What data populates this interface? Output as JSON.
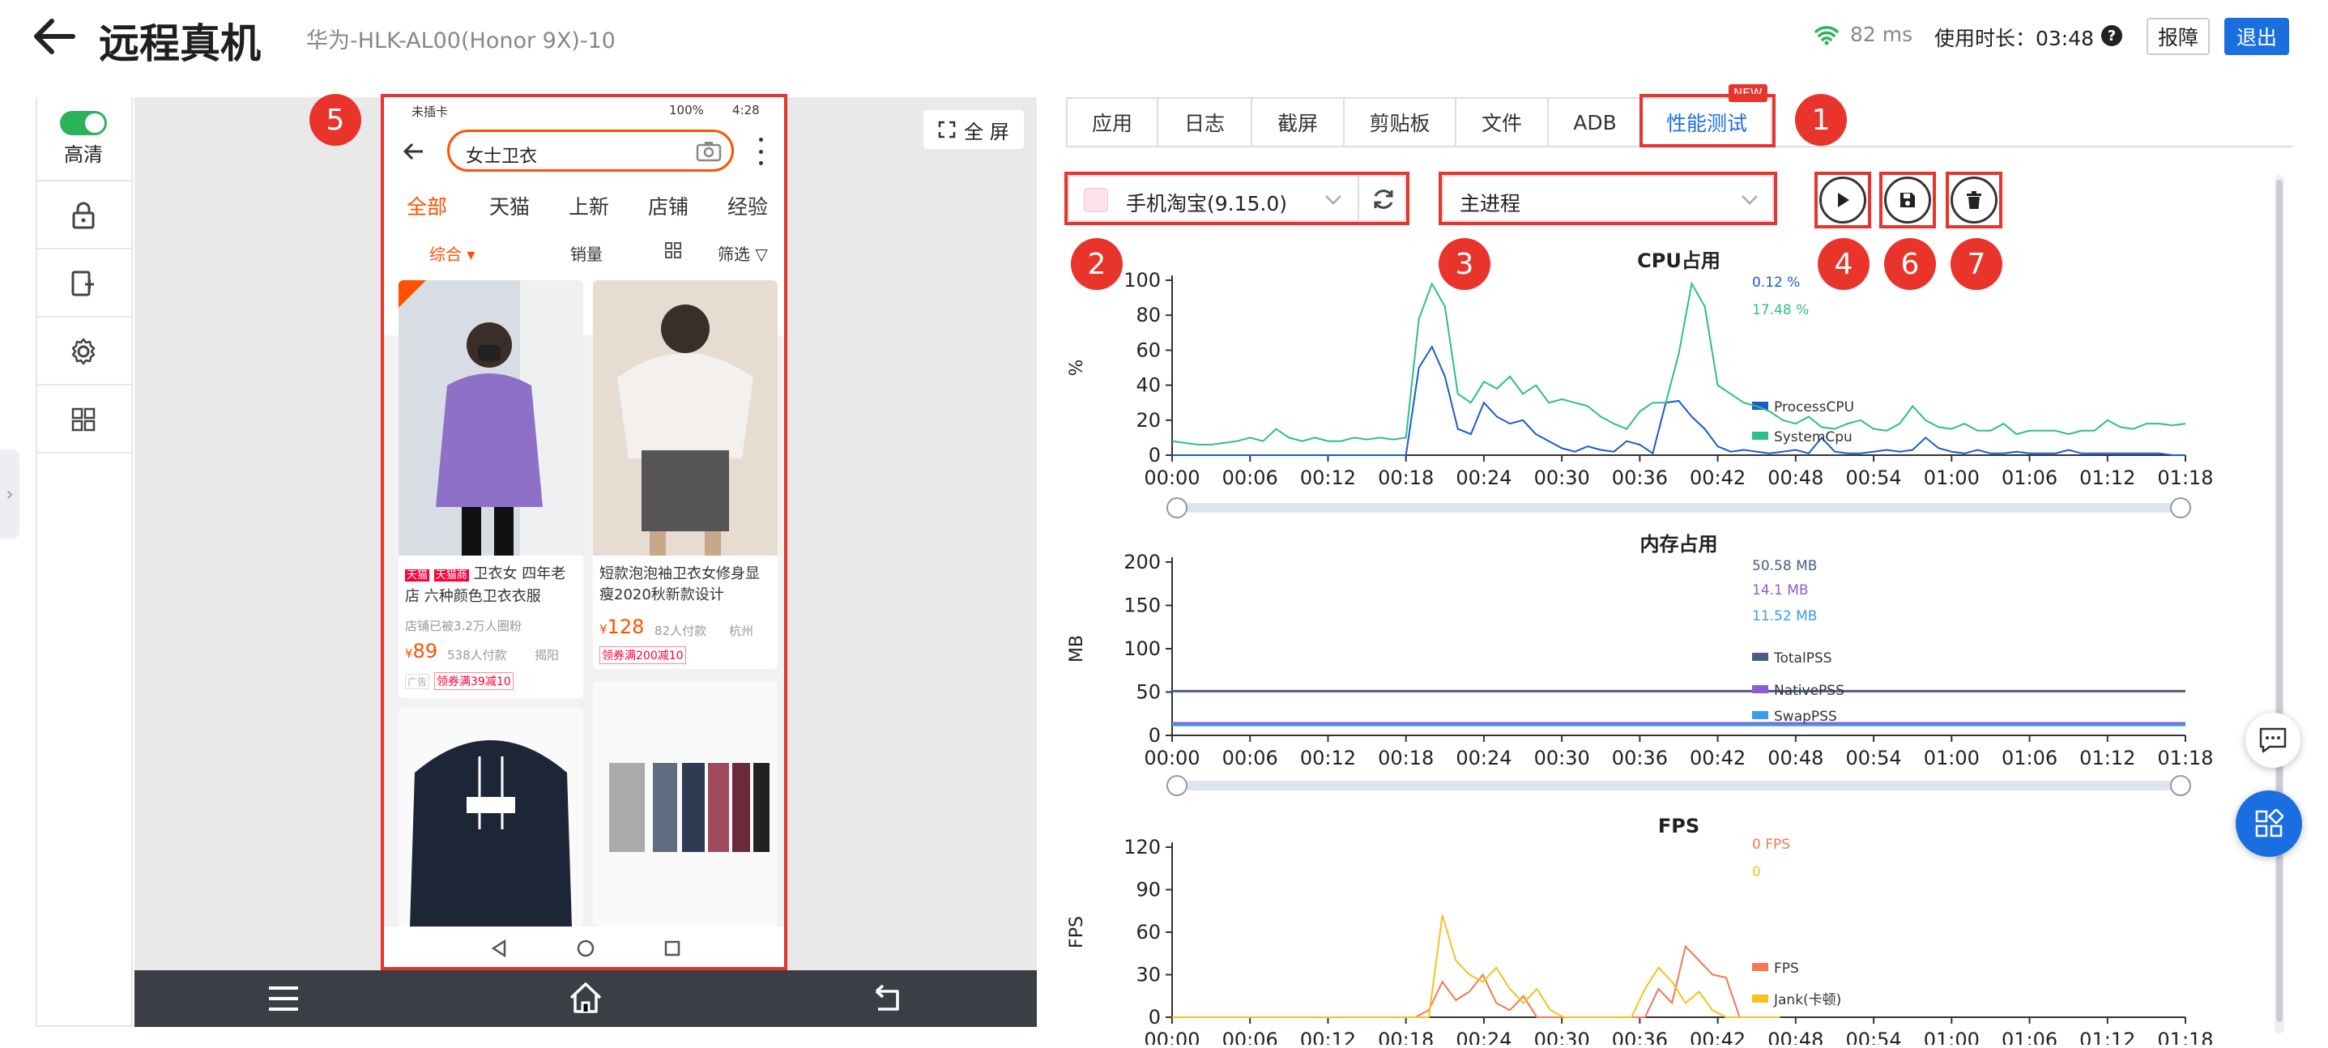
{
  "header": {
    "title": "远程真机",
    "device": "华为-HLK-AL00(Honor 9X)-10",
    "latency": "82 ms",
    "usage_label": "使用时长：03:48",
    "report_btn": "报障",
    "exit_btn": "退出",
    "help": "?"
  },
  "sidebar": {
    "hd_label": "高清"
  },
  "screen": {
    "fullscreen_label": "全 屏"
  },
  "phone": {
    "status_left": "未插卡",
    "status_right": "100% ",
    "status_time": "4:28",
    "search_text": "女士卫衣",
    "tabs": [
      "全部",
      "天猫",
      "上新",
      "店铺",
      "经验"
    ],
    "filters": [
      "综合",
      "销量",
      "筛选"
    ],
    "cards": [
      {
        "tag1": "天猫",
        "tag2": "天猫商",
        "title": "卫衣女 四年老店 六种颜色卫衣衣服",
        "sub": "店铺已被3.2万人圈粉",
        "price": "89",
        "sales": "538人付款",
        "loc": "揭阳",
        "coupon": "领券满39减10",
        "ad": "广告"
      },
      {
        "title": "短款泡泡袖卫衣女修身显瘦2020秋新款设计",
        "price": "128",
        "sales": "82人付款",
        "loc": "杭州",
        "coupon": "领券满200减10"
      }
    ],
    "yen": "¥"
  },
  "tabs": [
    "应用",
    "日志",
    "截屏",
    "剪贴板",
    "文件",
    "ADB",
    "性能测试"
  ],
  "new_badge": "NEW",
  "controls": {
    "app_select": "手机淘宝(9.15.0)",
    "process_select": "主进程"
  },
  "badges": [
    "1",
    "2",
    "3",
    "4",
    "5",
    "6",
    "7"
  ],
  "colors": {
    "accent": "#1a6fe0",
    "red": "#e8342b",
    "green": "#2ab35a",
    "orange": "#ff5000"
  },
  "x_ticks": [
    "00:00",
    "00:06",
    "00:12",
    "00:18",
    "00:24",
    "00:30",
    "00:36",
    "00:42",
    "00:48",
    "00:54",
    "01:00",
    "01:06",
    "01:12",
    "01:18"
  ],
  "chart_data": [
    {
      "type": "line",
      "title": "CPU占用",
      "ylabel": "%",
      "ylim": [
        0,
        100
      ],
      "yticks": [
        "0",
        "20",
        "40",
        "60",
        "80",
        "100"
      ],
      "x": [
        0,
        1,
        2,
        3,
        4,
        5,
        6,
        7,
        8,
        9,
        10,
        11,
        12,
        13,
        14,
        15,
        16,
        17,
        18,
        19,
        20,
        21,
        22,
        23,
        24,
        25,
        26,
        27,
        28,
        29,
        30,
        31,
        32,
        33,
        34,
        35,
        36,
        37,
        38,
        39,
        40,
        41,
        42,
        43,
        44,
        45,
        46,
        47,
        48,
        49,
        50,
        51,
        52,
        53,
        54,
        55,
        56,
        57,
        58,
        59,
        60,
        61,
        62,
        63,
        64,
        65,
        66,
        67,
        68,
        69,
        70,
        71,
        72,
        73,
        74,
        75,
        76,
        77,
        78
      ],
      "series": [
        {
          "name": "ProcessCPU",
          "color": "#1a5cc8",
          "value_label": "0.12 %",
          "values": [
            0,
            0,
            0,
            0,
            0,
            0,
            0,
            0,
            0,
            0,
            0,
            0,
            0,
            0,
            0,
            0,
            0,
            0,
            0,
            50,
            62,
            45,
            15,
            12,
            30,
            22,
            18,
            20,
            12,
            8,
            4,
            2,
            5,
            3,
            2,
            8,
            6,
            1,
            30,
            31,
            22,
            15,
            5,
            2,
            3,
            2,
            1,
            2,
            3,
            1,
            10,
            2,
            1,
            1,
            2,
            3,
            2,
            3,
            10,
            4,
            2,
            1,
            3,
            1,
            1,
            2,
            1,
            1,
            1,
            3,
            1,
            1,
            1,
            1,
            1,
            1,
            1,
            0,
            0
          ]
        },
        {
          "name": "SystemCpu",
          "color": "#2bbf8a",
          "value_label": "17.48 %",
          "values": [
            8,
            7,
            6,
            6,
            7,
            8,
            10,
            8,
            15,
            10,
            8,
            10,
            8,
            8,
            10,
            9,
            10,
            9,
            10,
            78,
            98,
            85,
            35,
            30,
            42,
            38,
            45,
            35,
            40,
            30,
            32,
            30,
            28,
            22,
            18,
            15,
            25,
            30,
            30,
            58,
            98,
            85,
            40,
            35,
            30,
            28,
            25,
            20,
            18,
            22,
            16,
            15,
            18,
            20,
            15,
            14,
            18,
            28,
            20,
            16,
            15,
            18,
            14,
            14,
            18,
            12,
            14,
            14,
            14,
            12,
            14,
            14,
            20,
            16,
            15,
            18,
            18,
            17,
            18
          ]
        }
      ]
    },
    {
      "type": "line",
      "title": "内存占用",
      "ylabel": "MB",
      "ylim": [
        0,
        200
      ],
      "yticks": [
        "0",
        "50",
        "100",
        "150",
        "200"
      ],
      "series": [
        {
          "name": "TotalPSS",
          "color": "#4a5d80",
          "value_label": "50.58 MB",
          "values": [
            51,
            51
          ]
        },
        {
          "name": "NativePSS",
          "color": "#8c5bd8",
          "value_label": "14.1 MB",
          "values": [
            14,
            14
          ]
        },
        {
          "name": "SwapPSS",
          "color": "#3b9de6",
          "value_label": "11.52 MB",
          "values": [
            12,
            12
          ]
        }
      ]
    },
    {
      "type": "line",
      "title": "FPS",
      "ylabel": "FPS",
      "ylim": [
        0,
        120
      ],
      "yticks": [
        "0",
        "30",
        "60",
        "90",
        "120"
      ],
      "x": [
        0,
        1,
        2,
        3,
        4,
        5,
        6,
        7,
        8,
        9,
        10,
        11,
        12,
        13,
        14,
        15,
        16,
        17,
        18,
        19,
        20,
        21,
        22,
        23,
        24,
        25,
        26,
        27,
        28,
        29,
        30,
        31,
        32,
        33,
        34,
        35,
        36,
        37,
        38,
        39,
        40,
        41,
        42,
        43,
        44,
        45
      ],
      "series": [
        {
          "name": "FPS",
          "color": "#f47850",
          "value_label": "0 FPS",
          "values": [
            0,
            0,
            0,
            0,
            0,
            0,
            0,
            0,
            0,
            0,
            0,
            0,
            0,
            0,
            0,
            0,
            0,
            0,
            0,
            5,
            25,
            12,
            18,
            30,
            10,
            5,
            15,
            0,
            0,
            0,
            0,
            0,
            0,
            0,
            0,
            0,
            20,
            10,
            50,
            40,
            30,
            28,
            0,
            0,
            0,
            0
          ]
        },
        {
          "name": "Jank(卡顿)",
          "color": "#f5c220",
          "value_label": "0",
          "values": [
            0,
            0,
            0,
            0,
            0,
            0,
            0,
            0,
            0,
            0,
            0,
            0,
            0,
            0,
            0,
            0,
            0,
            0,
            0,
            0,
            72,
            40,
            30,
            25,
            35,
            20,
            10,
            20,
            5,
            0,
            0,
            0,
            0,
            0,
            0,
            20,
            35,
            25,
            10,
            18,
            5,
            0,
            0,
            0,
            0,
            0
          ]
        }
      ]
    }
  ]
}
